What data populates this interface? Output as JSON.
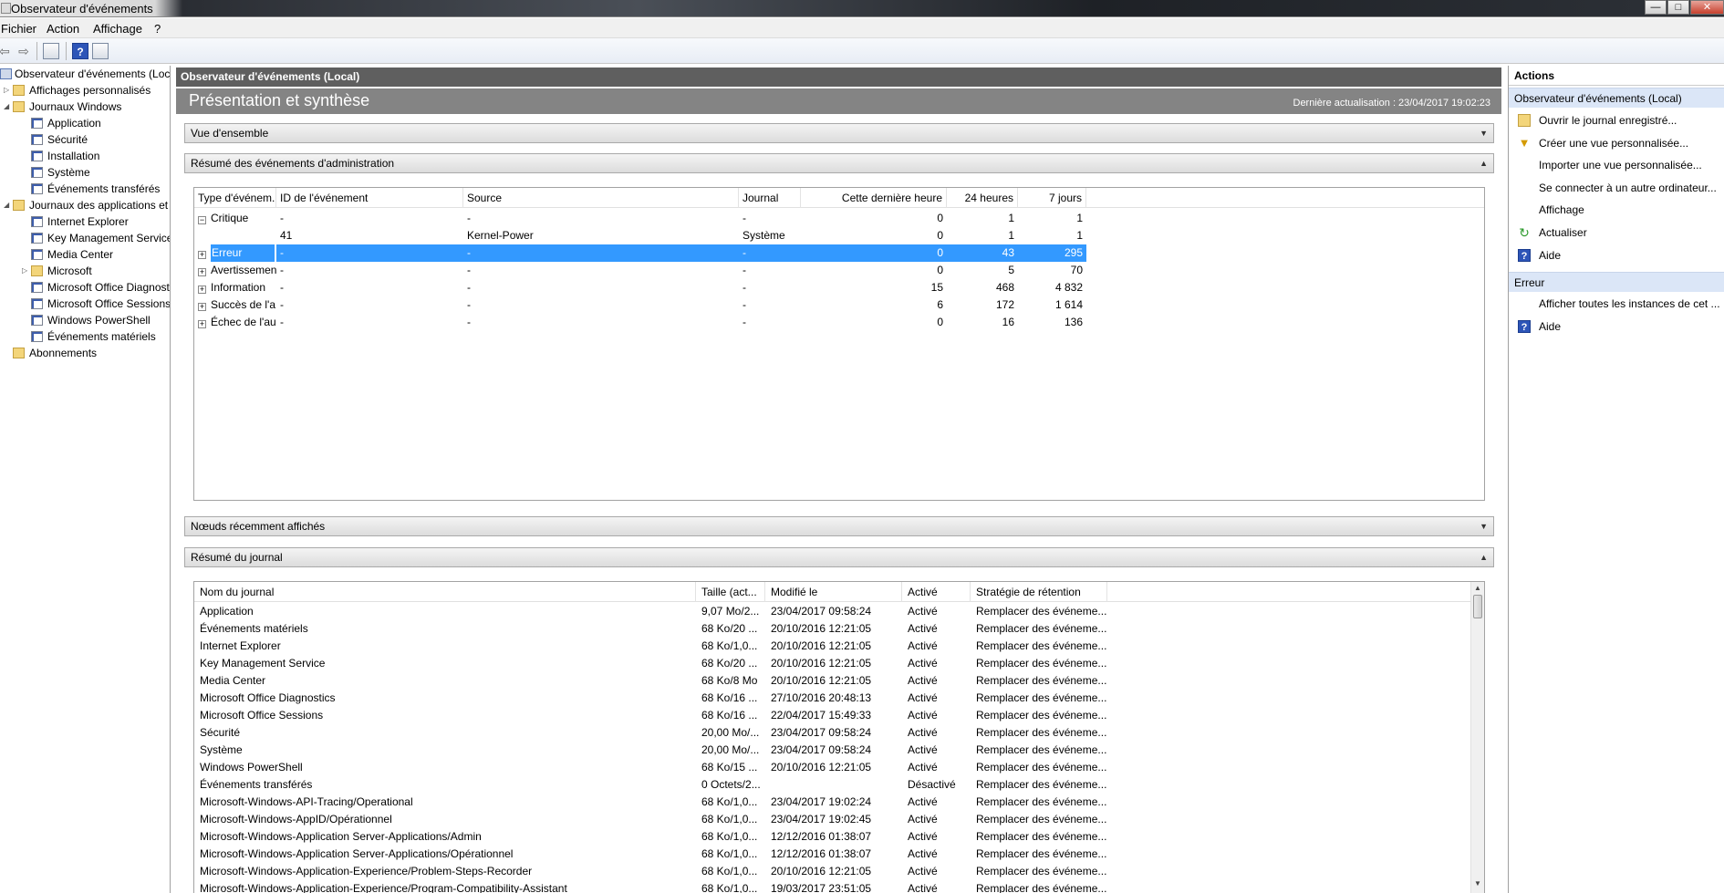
{
  "window": {
    "title": "Observateur d'événements",
    "controls": {
      "minimize": "—",
      "maximize": "□",
      "close": "✕"
    }
  },
  "menu": [
    "Fichier",
    "Action",
    "Affichage",
    "?"
  ],
  "tree": {
    "items": [
      {
        "label": "Observateur d'événements (Local)",
        "level": 0,
        "icon": "root",
        "expander": ""
      },
      {
        "label": "Affichages personnalisés",
        "level": 1,
        "icon": "folder",
        "expander": "▷"
      },
      {
        "label": "Journaux Windows",
        "level": 1,
        "icon": "folder",
        "expander": "◢"
      },
      {
        "label": "Application",
        "level": 2,
        "icon": "log",
        "expander": ""
      },
      {
        "label": "Sécurité",
        "level": 2,
        "icon": "log",
        "expander": ""
      },
      {
        "label": "Installation",
        "level": 2,
        "icon": "log",
        "expander": ""
      },
      {
        "label": "Système",
        "level": 2,
        "icon": "log",
        "expander": ""
      },
      {
        "label": "Événements transférés",
        "level": 2,
        "icon": "log",
        "expander": ""
      },
      {
        "label": "Journaux des applications et",
        "level": 1,
        "icon": "folder",
        "expander": "◢"
      },
      {
        "label": "Internet Explorer",
        "level": 2,
        "icon": "log",
        "expander": ""
      },
      {
        "label": "Key Management Service",
        "level": 2,
        "icon": "log",
        "expander": ""
      },
      {
        "label": "Media Center",
        "level": 2,
        "icon": "log",
        "expander": ""
      },
      {
        "label": "Microsoft",
        "level": 2,
        "icon": "folder",
        "expander": "▷"
      },
      {
        "label": "Microsoft Office Diagnostics",
        "level": 2,
        "icon": "log",
        "expander": ""
      },
      {
        "label": "Microsoft Office Sessions",
        "level": 2,
        "icon": "log",
        "expander": ""
      },
      {
        "label": "Windows PowerShell",
        "level": 2,
        "icon": "log",
        "expander": ""
      },
      {
        "label": "Événements matériels",
        "level": 2,
        "icon": "log",
        "expander": ""
      },
      {
        "label": "Abonnements",
        "level": 1,
        "icon": "folder",
        "expander": ""
      }
    ]
  },
  "center": {
    "header": "Observateur d'événements (Local)",
    "overview_title": "Présentation et synthèse",
    "last_update": "Dernière actualisation : 23/04/2017 19:02:23",
    "sections": {
      "overview": "Vue d'ensemble",
      "admin_summary": "Résumé des événements d'administration",
      "recent_nodes": "Nœuds récemment affichés",
      "log_summary": "Résumé du journal"
    },
    "admin_table": {
      "columns": [
        "Type d'événem...",
        "ID de l'événement",
        "Source",
        "Journal",
        "Cette dernière heure",
        "24 heures",
        "7 jours"
      ],
      "rows": [
        {
          "sign": "−",
          "type": "Critique",
          "id": "-",
          "source": "-",
          "journal": "-",
          "hour": "0",
          "day": "1",
          "week": "1",
          "selected": false
        },
        {
          "sign": "",
          "type": "",
          "id": "41",
          "source": "Kernel-Power",
          "journal": "Système",
          "hour": "0",
          "day": "1",
          "week": "1",
          "selected": false
        },
        {
          "sign": "+",
          "type": "Erreur",
          "id": "-",
          "source": "-",
          "journal": "-",
          "hour": "0",
          "day": "43",
          "week": "295",
          "selected": true
        },
        {
          "sign": "+",
          "type": "Avertissement",
          "id": "-",
          "source": "-",
          "journal": "-",
          "hour": "0",
          "day": "5",
          "week": "70",
          "selected": false
        },
        {
          "sign": "+",
          "type": "Information",
          "id": "-",
          "source": "-",
          "journal": "-",
          "hour": "15",
          "day": "468",
          "week": "4 832",
          "selected": false
        },
        {
          "sign": "+",
          "type": "Succès de l'a...",
          "id": "-",
          "source": "-",
          "journal": "-",
          "hour": "6",
          "day": "172",
          "week": "1 614",
          "selected": false
        },
        {
          "sign": "+",
          "type": "Échec de l'au...",
          "id": "-",
          "source": "-",
          "journal": "-",
          "hour": "0",
          "day": "16",
          "week": "136",
          "selected": false
        }
      ]
    },
    "log_table": {
      "columns": [
        "Nom du journal",
        "Taille (act...",
        "Modifié le",
        "Activé",
        "Stratégie de rétention"
      ],
      "rows": [
        [
          "Application",
          "9,07 Mo/2...",
          "23/04/2017 09:58:24",
          "Activé",
          "Remplacer des événeme..."
        ],
        [
          "Événements matériels",
          "68 Ko/20 ...",
          "20/10/2016 12:21:05",
          "Activé",
          "Remplacer des événeme..."
        ],
        [
          "Internet Explorer",
          "68 Ko/1,0...",
          "20/10/2016 12:21:05",
          "Activé",
          "Remplacer des événeme..."
        ],
        [
          "Key Management Service",
          "68 Ko/20 ...",
          "20/10/2016 12:21:05",
          "Activé",
          "Remplacer des événeme..."
        ],
        [
          "Media Center",
          "68 Ko/8 Mo",
          "20/10/2016 12:21:05",
          "Activé",
          "Remplacer des événeme..."
        ],
        [
          "Microsoft Office Diagnostics",
          "68 Ko/16 ...",
          "27/10/2016 20:48:13",
          "Activé",
          "Remplacer des événeme..."
        ],
        [
          "Microsoft Office Sessions",
          "68 Ko/16 ...",
          "22/04/2017 15:49:33",
          "Activé",
          "Remplacer des événeme..."
        ],
        [
          "Sécurité",
          "20,00 Mo/...",
          "23/04/2017 09:58:24",
          "Activé",
          "Remplacer des événeme..."
        ],
        [
          "Système",
          "20,00 Mo/...",
          "23/04/2017 09:58:24",
          "Activé",
          "Remplacer des événeme..."
        ],
        [
          "Windows PowerShell",
          "68 Ko/15 ...",
          "20/10/2016 12:21:05",
          "Activé",
          "Remplacer des événeme..."
        ],
        [
          "Événements transférés",
          "0 Octets/2...",
          "",
          "Désactivé",
          "Remplacer des événeme..."
        ],
        [
          "Microsoft-Windows-API-Tracing/Operational",
          "68 Ko/1,0...",
          "23/04/2017 19:02:24",
          "Activé",
          "Remplacer des événeme..."
        ],
        [
          "Microsoft-Windows-AppID/Opérationnel",
          "68 Ko/1,0...",
          "23/04/2017 19:02:45",
          "Activé",
          "Remplacer des événeme..."
        ],
        [
          "Microsoft-Windows-Application Server-Applications/Admin",
          "68 Ko/1,0...",
          "12/12/2016 01:38:07",
          "Activé",
          "Remplacer des événeme..."
        ],
        [
          "Microsoft-Windows-Application Server-Applications/Opérationnel",
          "68 Ko/1,0...",
          "12/12/2016 01:38:07",
          "Activé",
          "Remplacer des événeme..."
        ],
        [
          "Microsoft-Windows-Application-Experience/Problem-Steps-Recorder",
          "68 Ko/1,0...",
          "20/10/2016 12:21:05",
          "Activé",
          "Remplacer des événeme..."
        ],
        [
          "Microsoft-Windows-Application-Experience/Program-Compatibility-Assistant",
          "68 Ko/1,0...",
          "19/03/2017 23:51:05",
          "Activé",
          "Remplacer des événeme..."
        ]
      ]
    }
  },
  "actions": {
    "title": "Actions",
    "group1": {
      "header": "Observateur d'événements (Local)",
      "items": [
        {
          "label": "Ouvrir le journal enregistré...",
          "icon": "open"
        },
        {
          "label": "Créer une vue personnalisée...",
          "icon": "filter"
        },
        {
          "label": "Importer une vue personnalisée...",
          "icon": ""
        },
        {
          "label": "Se connecter à un autre ordinateur...",
          "icon": ""
        },
        {
          "label": "Affichage",
          "icon": ""
        },
        {
          "label": "Actualiser",
          "icon": "refresh"
        },
        {
          "label": "Aide",
          "icon": "help"
        }
      ]
    },
    "group2": {
      "header": "Erreur",
      "items": [
        {
          "label": "Afficher toutes les instances de cet ...",
          "icon": ""
        },
        {
          "label": "Aide",
          "icon": "help"
        }
      ]
    }
  }
}
